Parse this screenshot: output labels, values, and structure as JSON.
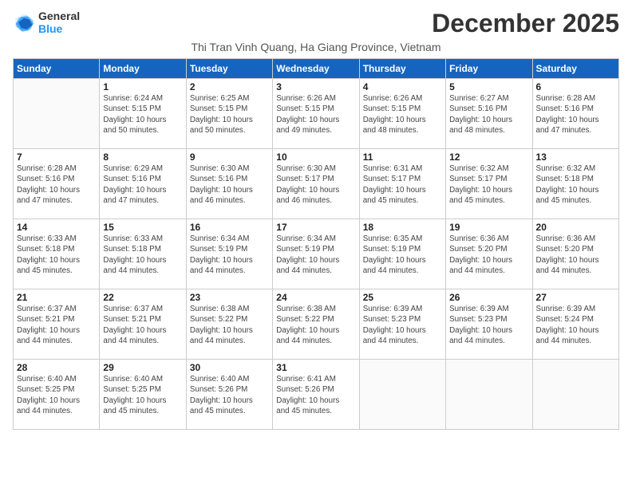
{
  "logo": {
    "line1": "General",
    "line2": "Blue"
  },
  "title": "December 2025",
  "subtitle": "Thi Tran Vinh Quang, Ha Giang Province, Vietnam",
  "days_of_week": [
    "Sunday",
    "Monday",
    "Tuesday",
    "Wednesday",
    "Thursday",
    "Friday",
    "Saturday"
  ],
  "weeks": [
    [
      {
        "day": "",
        "info": ""
      },
      {
        "day": "1",
        "info": "Sunrise: 6:24 AM\nSunset: 5:15 PM\nDaylight: 10 hours\nand 50 minutes."
      },
      {
        "day": "2",
        "info": "Sunrise: 6:25 AM\nSunset: 5:15 PM\nDaylight: 10 hours\nand 50 minutes."
      },
      {
        "day": "3",
        "info": "Sunrise: 6:26 AM\nSunset: 5:15 PM\nDaylight: 10 hours\nand 49 minutes."
      },
      {
        "day": "4",
        "info": "Sunrise: 6:26 AM\nSunset: 5:15 PM\nDaylight: 10 hours\nand 48 minutes."
      },
      {
        "day": "5",
        "info": "Sunrise: 6:27 AM\nSunset: 5:16 PM\nDaylight: 10 hours\nand 48 minutes."
      },
      {
        "day": "6",
        "info": "Sunrise: 6:28 AM\nSunset: 5:16 PM\nDaylight: 10 hours\nand 47 minutes."
      }
    ],
    [
      {
        "day": "7",
        "info": "Sunrise: 6:28 AM\nSunset: 5:16 PM\nDaylight: 10 hours\nand 47 minutes."
      },
      {
        "day": "8",
        "info": "Sunrise: 6:29 AM\nSunset: 5:16 PM\nDaylight: 10 hours\nand 47 minutes."
      },
      {
        "day": "9",
        "info": "Sunrise: 6:30 AM\nSunset: 5:16 PM\nDaylight: 10 hours\nand 46 minutes."
      },
      {
        "day": "10",
        "info": "Sunrise: 6:30 AM\nSunset: 5:17 PM\nDaylight: 10 hours\nand 46 minutes."
      },
      {
        "day": "11",
        "info": "Sunrise: 6:31 AM\nSunset: 5:17 PM\nDaylight: 10 hours\nand 45 minutes."
      },
      {
        "day": "12",
        "info": "Sunrise: 6:32 AM\nSunset: 5:17 PM\nDaylight: 10 hours\nand 45 minutes."
      },
      {
        "day": "13",
        "info": "Sunrise: 6:32 AM\nSunset: 5:18 PM\nDaylight: 10 hours\nand 45 minutes."
      }
    ],
    [
      {
        "day": "14",
        "info": "Sunrise: 6:33 AM\nSunset: 5:18 PM\nDaylight: 10 hours\nand 45 minutes."
      },
      {
        "day": "15",
        "info": "Sunrise: 6:33 AM\nSunset: 5:18 PM\nDaylight: 10 hours\nand 44 minutes."
      },
      {
        "day": "16",
        "info": "Sunrise: 6:34 AM\nSunset: 5:19 PM\nDaylight: 10 hours\nand 44 minutes."
      },
      {
        "day": "17",
        "info": "Sunrise: 6:34 AM\nSunset: 5:19 PM\nDaylight: 10 hours\nand 44 minutes."
      },
      {
        "day": "18",
        "info": "Sunrise: 6:35 AM\nSunset: 5:19 PM\nDaylight: 10 hours\nand 44 minutes."
      },
      {
        "day": "19",
        "info": "Sunrise: 6:36 AM\nSunset: 5:20 PM\nDaylight: 10 hours\nand 44 minutes."
      },
      {
        "day": "20",
        "info": "Sunrise: 6:36 AM\nSunset: 5:20 PM\nDaylight: 10 hours\nand 44 minutes."
      }
    ],
    [
      {
        "day": "21",
        "info": "Sunrise: 6:37 AM\nSunset: 5:21 PM\nDaylight: 10 hours\nand 44 minutes."
      },
      {
        "day": "22",
        "info": "Sunrise: 6:37 AM\nSunset: 5:21 PM\nDaylight: 10 hours\nand 44 minutes."
      },
      {
        "day": "23",
        "info": "Sunrise: 6:38 AM\nSunset: 5:22 PM\nDaylight: 10 hours\nand 44 minutes."
      },
      {
        "day": "24",
        "info": "Sunrise: 6:38 AM\nSunset: 5:22 PM\nDaylight: 10 hours\nand 44 minutes."
      },
      {
        "day": "25",
        "info": "Sunrise: 6:39 AM\nSunset: 5:23 PM\nDaylight: 10 hours\nand 44 minutes."
      },
      {
        "day": "26",
        "info": "Sunrise: 6:39 AM\nSunset: 5:23 PM\nDaylight: 10 hours\nand 44 minutes."
      },
      {
        "day": "27",
        "info": "Sunrise: 6:39 AM\nSunset: 5:24 PM\nDaylight: 10 hours\nand 44 minutes."
      }
    ],
    [
      {
        "day": "28",
        "info": "Sunrise: 6:40 AM\nSunset: 5:25 PM\nDaylight: 10 hours\nand 44 minutes."
      },
      {
        "day": "29",
        "info": "Sunrise: 6:40 AM\nSunset: 5:25 PM\nDaylight: 10 hours\nand 45 minutes."
      },
      {
        "day": "30",
        "info": "Sunrise: 6:40 AM\nSunset: 5:26 PM\nDaylight: 10 hours\nand 45 minutes."
      },
      {
        "day": "31",
        "info": "Sunrise: 6:41 AM\nSunset: 5:26 PM\nDaylight: 10 hours\nand 45 minutes."
      },
      {
        "day": "",
        "info": ""
      },
      {
        "day": "",
        "info": ""
      },
      {
        "day": "",
        "info": ""
      }
    ]
  ]
}
